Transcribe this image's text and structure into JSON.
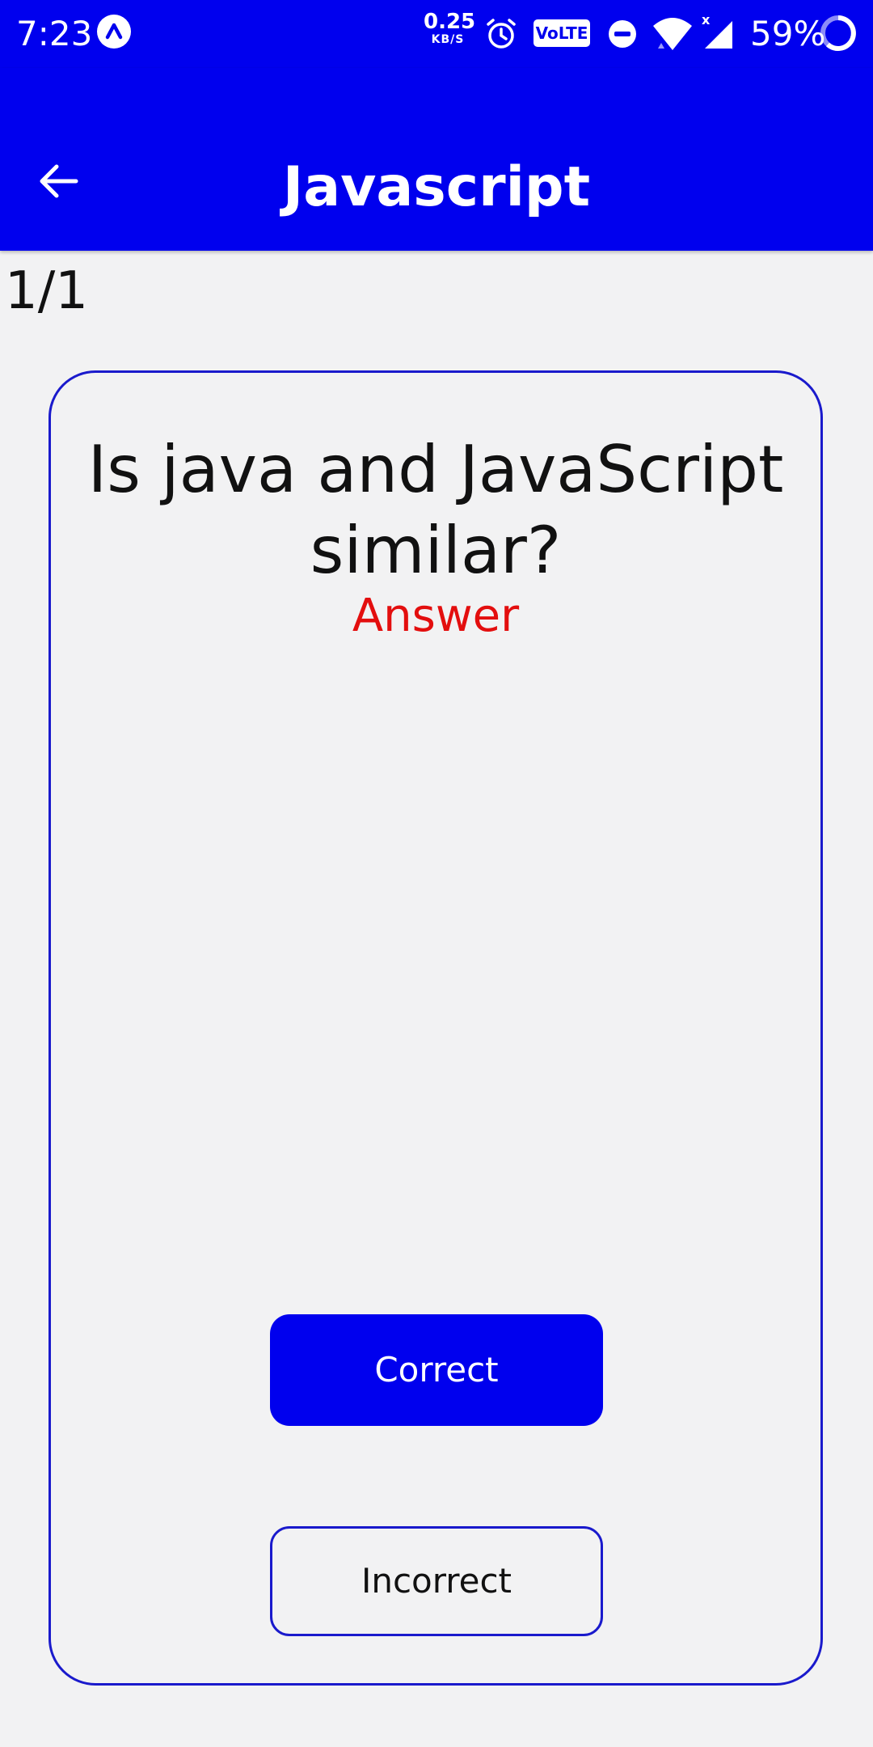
{
  "status_bar": {
    "time": "7:23",
    "app_icon": "arrow-up-circle-icon",
    "net_speed_value": "0.25",
    "net_speed_unit": "KB/S",
    "volte_label": "VoLTE",
    "battery_percent": "59%",
    "icons": [
      "alarm-icon",
      "volte-icon",
      "do-not-disturb-icon",
      "wifi-icon",
      "cell-signal-icon",
      "battery-icon"
    ]
  },
  "app_bar": {
    "title": "Javascript",
    "back_icon": "back-arrow-icon"
  },
  "progress": {
    "counter": "1/1"
  },
  "card": {
    "question": "Is java and JavaScript similar?",
    "answer_label": "Answer",
    "correct_label": "Correct",
    "incorrect_label": "Incorrect"
  },
  "colors": {
    "primary": "#0000ee",
    "background": "#f2f2f3",
    "answer": "#e30e0e",
    "card_border": "#1a1acc"
  }
}
